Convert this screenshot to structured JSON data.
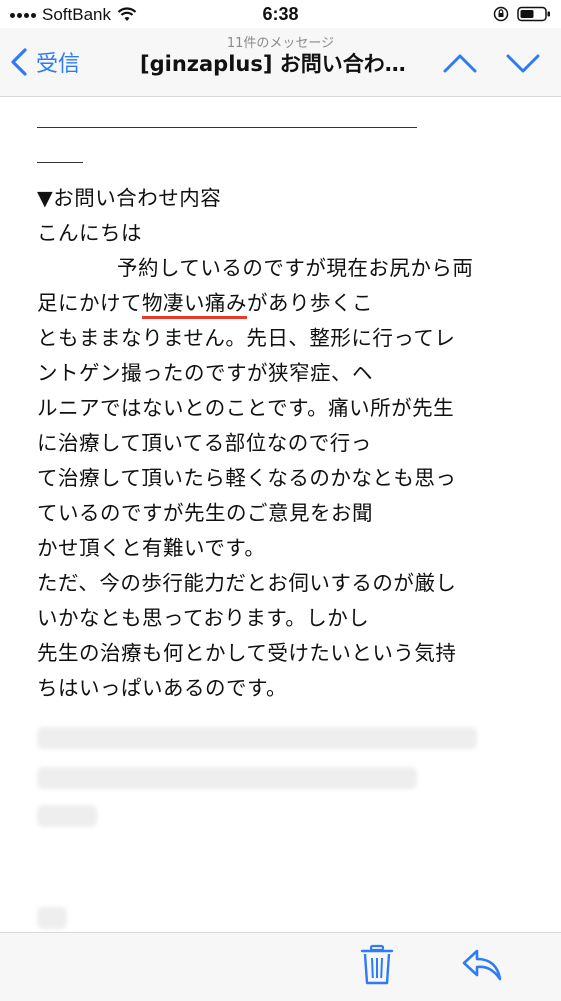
{
  "status_bar": {
    "carrier": "SoftBank",
    "time": "6:38",
    "icons": [
      "signal-dots-icon",
      "wifi-icon",
      "orientation-lock-icon",
      "battery-icon"
    ]
  },
  "nav": {
    "back_label": "受信",
    "subtitle": "11件のメッセージ",
    "title": "[ginzaplus] お問い合わ…",
    "icons": [
      "back-chevron-icon",
      "up-chevron-icon",
      "down-chevron-icon"
    ],
    "accent_color": "#2f7bf5"
  },
  "message": {
    "section_heading": "▼お問い合わせ内容",
    "greeting": "こんにちは",
    "line1": "予約しているのですが現在お尻から両",
    "line2_pre": "足にかけて",
    "line2_highlight": "物凄い痛み",
    "line2_post": "があり歩くこ",
    "line3": "ともままなりません。先日、整形に行ってレ",
    "line4": "ントゲン撮ったのですが狭窄症、ヘ",
    "line5": "ルニアではないとのことです。痛い所が先生",
    "line6": "に治療して頂いてる部位なので行っ",
    "line7": "て治療して頂いたら軽くなるのかなとも思っ",
    "line8": "ているのですが先生のご意見をお聞",
    "line9": "かせ頂くと有難いです。",
    "line10": "ただ、今の歩行能力だとお伺いするのが厳し",
    "line11": "いかなとも思っております。しかし",
    "line12": "先生の治療も何とかして受けたいという気持",
    "line13": "ちはいっぱいあるのです。",
    "highlight_color": "#e53b2b"
  },
  "toolbar": {
    "icons": [
      "trash-icon",
      "reply-icon"
    ]
  }
}
